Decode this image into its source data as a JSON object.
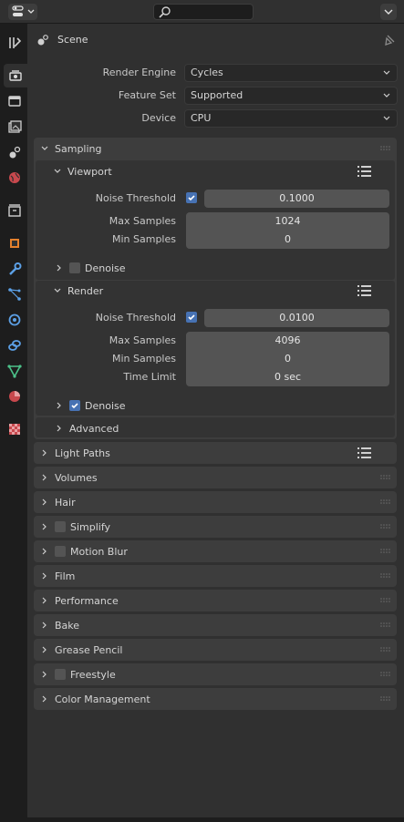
{
  "header": {
    "search_placeholder": ""
  },
  "context": {
    "title": "Scene"
  },
  "sidebar": {
    "tabs": [
      {
        "icon": "tool-icon"
      },
      {
        "icon": "render-icon"
      },
      {
        "icon": "output-icon"
      },
      {
        "icon": "view-layer-icon"
      },
      {
        "icon": "scene-icon"
      },
      {
        "icon": "world-icon"
      },
      {
        "icon": "collection-icon"
      },
      {
        "icon": "object-icon"
      },
      {
        "icon": "modifier-icon"
      },
      {
        "icon": "particles-icon"
      },
      {
        "icon": "physics-icon"
      },
      {
        "icon": "constraints-icon"
      },
      {
        "icon": "data-icon"
      },
      {
        "icon": "material-icon"
      },
      {
        "icon": "texture-icon"
      }
    ]
  },
  "render_settings": {
    "engine_label": "Render Engine",
    "engine_value": "Cycles",
    "feature_label": "Feature Set",
    "feature_value": "Supported",
    "device_label": "Device",
    "device_value": "CPU"
  },
  "sampling": {
    "title": "Sampling",
    "viewport": {
      "title": "Viewport",
      "noise_threshold_label": "Noise Threshold",
      "noise_threshold_value": "0.1000",
      "max_samples_label": "Max Samples",
      "max_samples_value": "1024",
      "min_samples_label": "Min Samples",
      "min_samples_value": "0",
      "denoise_label": "Denoise"
    },
    "render": {
      "title": "Render",
      "noise_threshold_label": "Noise Threshold",
      "noise_threshold_value": "0.0100",
      "max_samples_label": "Max Samples",
      "max_samples_value": "4096",
      "min_samples_label": "Min Samples",
      "min_samples_value": "0",
      "time_limit_label": "Time Limit",
      "time_limit_value": "0 sec",
      "denoise_label": "Denoise"
    },
    "advanced": "Advanced"
  },
  "panels": {
    "light_paths": "Light Paths",
    "volumes": "Volumes",
    "hair": "Hair",
    "simplify": "Simplify",
    "motion_blur": "Motion Blur",
    "film": "Film",
    "performance": "Performance",
    "bake": "Bake",
    "grease_pencil": "Grease Pencil",
    "freestyle": "Freestyle",
    "color_management": "Color Management"
  },
  "colors": {
    "accent": "#4772b3",
    "background": "#303030",
    "panel": "#3d3d3d"
  }
}
